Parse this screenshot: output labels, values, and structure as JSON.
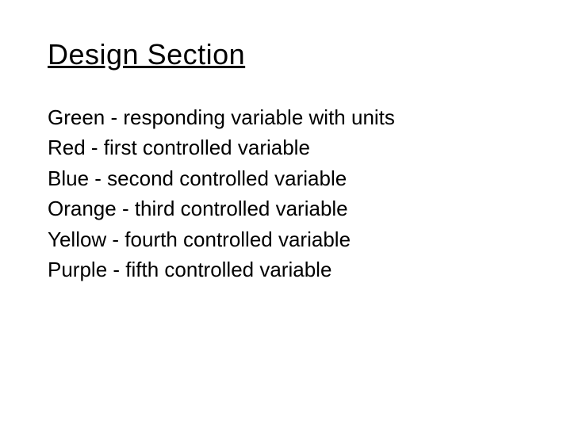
{
  "title": "Design Section",
  "items": [
    "Green - responding variable with units",
    "Red - first controlled variable",
    "Blue - second controlled variable",
    "Orange - third controlled variable",
    "Yellow - fourth controlled variable",
    "Purple - fifth controlled variable"
  ]
}
